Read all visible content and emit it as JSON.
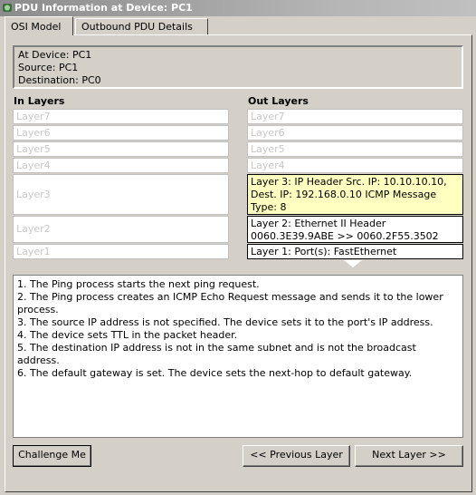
{
  "window": {
    "title": "PDU Information at Device: PC1"
  },
  "tabs": [
    {
      "label": "OSI Model",
      "active": true
    },
    {
      "label": "Outbound PDU Details",
      "active": false
    }
  ],
  "info": {
    "device": "At Device: PC1",
    "source": "Source: PC1",
    "destination": "Destination: PC0"
  },
  "in_layers": {
    "header": "In Layers",
    "items": [
      "Layer7",
      "Layer6",
      "Layer5",
      "Layer4",
      "Layer3",
      "Layer2",
      "Layer1"
    ]
  },
  "out_layers": {
    "header": "Out Layers",
    "items": [
      "Layer7",
      "Layer6",
      "Layer5",
      "Layer4",
      "Layer 3: IP Header Src. IP: 10.10.10.10, Dest. IP: 192.168.0.10 ICMP Message Type: 8",
      "Layer 2: Ethernet II Header 0060.3E39.9ABE >> 0060.2F55.3502",
      "Layer 1: Port(s): FastEthernet"
    ]
  },
  "steps": [
    "1. The Ping process starts the next ping request.",
    "2. The Ping process creates an ICMP Echo Request message and sends it to the lower process.",
    "3. The source IP address is not specified. The device sets it to the port's IP address.",
    "4. The device sets TTL in the packet header.",
    "5. The destination IP address is not in the same subnet and is not the broadcast address.",
    "6. The default gateway is set. The device sets the next-hop to default gateway."
  ],
  "buttons": {
    "challenge": "Challenge Me",
    "previous": "<< Previous Layer",
    "next": "Next Layer >>"
  },
  "colors": {
    "highlight_layer": "#ffffc0",
    "inactive_text": "#c8c8c8",
    "panel": "#d4d0c8"
  }
}
